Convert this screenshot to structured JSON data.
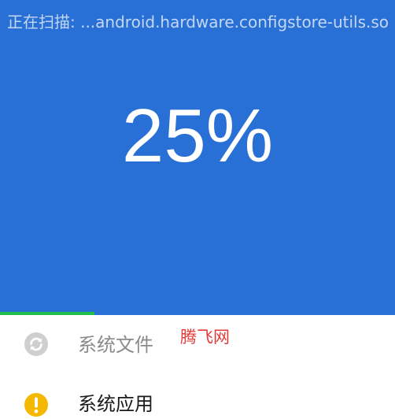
{
  "scan": {
    "text": "正在扫描: ...android.hardware.configstore-utils.so",
    "percent_text": "25%",
    "progress": 0.24
  },
  "items": [
    {
      "label": "系统文件",
      "icon": "refresh-icon",
      "state": "scanning",
      "color": "#cfcfcf"
    },
    {
      "label": "系统应用",
      "icon": "warning-icon",
      "state": "warning",
      "color": "#f5b800"
    }
  ],
  "watermark": "腾飞网",
  "colors": {
    "header_background": "#2870d6",
    "progress": "#1fbf4a",
    "watermark": "#e23a3a"
  }
}
